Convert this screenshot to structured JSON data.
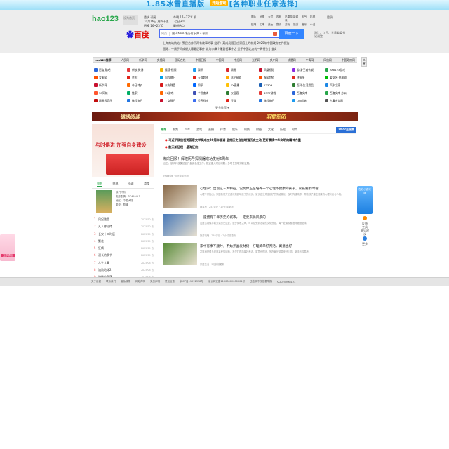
{
  "top_ad": {
    "title": "1.85冰雪直播版",
    "button": "开始游戏",
    "subtitle": "[各种职业任意选择]"
  },
  "header": {
    "logo": "hao123",
    "city": "设为首页",
    "weather": [
      "重庆 订阅",
      "今明 17~23°C 阴",
      "10月16日 周四十五",
      "今天",
      "七日天气",
      "明晚 16~23°C",
      "最新热点",
      "最新动态"
    ],
    "chat": "聊天",
    "quick_links": [
      "图片",
      "地图",
      "大学",
      "视频",
      "迅雷游戏",
      "新闻",
      "天气",
      "影视",
      "贴吧",
      "汇率",
      "美女",
      "翻译",
      "游戏",
      "旅游",
      "音乐",
      "小说"
    ],
    "login": "登录",
    "search_engine_logo": "百度",
    "search_select": "网页",
    "search_value": "国内NBA球员荷乐真人被抓",
    "search_button": "百度一下",
    "search_side": "浙江、江西、甘肃省委书记调整"
  },
  "news": [
    "上海南站航站：警民合作不再有故事的事  批评：某成员国回应家庭上的新规  2025年中国政府工作报告",
    "国际：一周子问成绩大幕最后事件  认为李峰个硬重视事件之  关于中国北方的一周行头 | 推文"
  ],
  "nav": [
    "hao123推荐",
    "人民网",
    "新华网",
    "央视网",
    "国际在线",
    "中国日报",
    "中国网",
    "中经网",
    "光明网",
    "央广网",
    "求是网",
    "中青网",
    "网信网",
    "中国政府网"
  ],
  "sites": [
    {
      "label": "百度·贴吧",
      "icon": "baidu-icon",
      "color": "#2b66d9"
    },
    {
      "label": "新浪·微博",
      "icon": "weibo-icon",
      "color": "#e4393c"
    },
    {
      "label": "搜狐·视频",
      "icon": "sohu-icon",
      "color": "#f0b400"
    },
    {
      "label": "腾讯",
      "icon": "qq-icon",
      "color": "#1d9bf0"
    },
    {
      "label": "网易",
      "icon": "netease-icon",
      "color": "#d8282f"
    },
    {
      "label": "凤凰视频",
      "icon": "ifeng-icon",
      "color": "#c8102e"
    },
    {
      "label": "游戏·王者传说",
      "icon": "game-icon",
      "color": "#8a2be2"
    },
    {
      "label": "hao123游戏",
      "icon": "hao-icon",
      "color": "#27a64a"
    },
    {
      "label": "爱淘宝",
      "icon": "taobao-icon",
      "color": "#ff5000"
    },
    {
      "label": "京东",
      "icon": "jd-icon",
      "color": "#e1251b"
    },
    {
      "label": "同程旅行",
      "icon": "ly-icon",
      "color": "#00a0e9"
    },
    {
      "label": "天猫超市",
      "icon": "tmall-icon",
      "color": "#e1251b"
    },
    {
      "label": "苏宁易购",
      "icon": "suning-icon",
      "color": "#ffaa00"
    },
    {
      "label": "淘宝特价",
      "icon": "taote-icon",
      "color": "#ff5000"
    },
    {
      "label": "拼多多",
      "icon": "pdd-icon",
      "color": "#e02e24"
    },
    {
      "label": "爱奇艺·电视剧",
      "icon": "iqiyi-icon",
      "color": "#00be06"
    },
    {
      "label": "新华网",
      "icon": "xinhua-icon",
      "color": "#c8102e"
    },
    {
      "label": "今日特价",
      "icon": "deal-icon",
      "color": "#ff6a00"
    },
    {
      "label": "东方财富",
      "icon": "eastmoney-icon",
      "color": "#d71a1a"
    },
    {
      "label": "知乎",
      "icon": "zhihu-icon",
      "color": "#0066ff"
    },
    {
      "label": "YY直播",
      "icon": "yy-icon",
      "color": "#ffc107"
    },
    {
      "label": "12306",
      "icon": "railway-icon",
      "color": "#1a5fb4"
    },
    {
      "label": "百科·生活用品",
      "icon": "baike-icon",
      "color": "#2e7d32"
    },
    {
      "label": "汽车之家",
      "icon": "autohome-icon",
      "color": "#1e88e5"
    },
    {
      "label": "58同城",
      "icon": "58-icon",
      "color": "#ff552e"
    },
    {
      "label": "链家",
      "icon": "lianjia-icon",
      "color": "#00ae66"
    },
    {
      "label": "31游戏",
      "icon": "g31-icon",
      "color": "#ff6600"
    },
    {
      "label": "个税查询",
      "icon": "tax-icon",
      "color": "#3f51b5"
    },
    {
      "label": "安居客",
      "icon": "anjuke-icon",
      "color": "#2e7d32"
    },
    {
      "label": "4377游戏",
      "icon": "g4377-icon",
      "color": "#e53935"
    },
    {
      "label": "百度文库",
      "icon": "wenku-icon",
      "color": "#2b66d9"
    },
    {
      "label": "百度文库·办公",
      "icon": "office-icon",
      "color": "#27a64a"
    },
    {
      "label": "网易云音乐",
      "icon": "music-icon",
      "color": "#c20c0c"
    },
    {
      "label": "携程旅行",
      "icon": "ctrip-icon",
      "color": "#2577e3"
    },
    {
      "label": "工商银行",
      "icon": "bank-icon",
      "color": "#c8102e"
    },
    {
      "label": "贝壳找房",
      "icon": "beike-icon",
      "color": "#3c6ef0"
    },
    {
      "label": "天猫",
      "icon": "tmall2-icon",
      "color": "#e1251b"
    },
    {
      "label": "携程旅行",
      "icon": "trip-icon",
      "color": "#2577e3"
    },
    {
      "label": "QQ邮箱",
      "icon": "mail-icon",
      "color": "#1d9bf0"
    },
    {
      "label": "人事考试网",
      "icon": "exam-icon",
      "color": "#555555"
    }
  ],
  "more_label": "更多推荐 ▾",
  "ad_strip": {
    "left": "锦绣阅读",
    "right": "明星军团"
  },
  "left_banner": {
    "text": "与时俱进 加强自身建设"
  },
  "left_tabs": [
    "电影",
    "电视",
    "小说",
    "游戏"
  ],
  "book": {
    "title": "我们只有",
    "lines": [
      "电影剧情：374904 ↑",
      "地区：中国大陆",
      "类型：剧情"
    ]
  },
  "rank": [
    {
      "n": "1",
      "t": "风起陇西",
      "h": "2025/10 热"
    },
    {
      "n": "2",
      "t": "凡人修仙传",
      "h": "2025/10 热"
    },
    {
      "n": "3",
      "t": "长安十二时辰",
      "h": "2025/09 热"
    },
    {
      "n": "4",
      "t": "繁花",
      "h": "2025/09 热"
    },
    {
      "n": "5",
      "t": "狂飙",
      "h": "2025/09 热"
    },
    {
      "n": "6",
      "t": "漫长的季节",
      "h": "2025/09 热"
    },
    {
      "n": "7",
      "t": "人生大事",
      "h": "2025/08 热"
    },
    {
      "n": "8",
      "t": "流浪地球2",
      "h": "2025/08 热"
    },
    {
      "n": "9",
      "t": "隐秘的角落",
      "h": "2025/08 热"
    },
    {
      "n": "10",
      "t": "沉默的真相",
      "h": "2025/08 热"
    }
  ],
  "feed_tabs": [
    "推荐",
    "视频",
    "汽车",
    "游戏",
    "直播",
    "体育",
    "娱乐",
    "科技",
    "财经",
    "文化",
    "历史",
    "时尚"
  ],
  "feed_special": "2022全国赛",
  "headlines": [
    "习近平致信祝贺国家文学奖成立20周年强调 坚定历史自信增强历史主动 更好赓续中华文明的精神力量",
    "航天新征程 | 星海征航"
  ],
  "lead": {
    "title": "精彩回顾！辉煌历号探测器成功发射6周年",
    "desc": "近日，航天科技集团召开会议总结工作，推进重大项目研制，多项任务取得新进展。",
    "meta": "环球时报 · 5分钟前更新"
  },
  "cards": [
    {
      "title": "心理学：出现这三大特征，说明你正在培养一个心理不健康的孩子，家长要及时看…",
      "desc": "心理专家指出，家庭教育方式会深刻影响孩子的成长，家长应当关注孩子的情绪变化，及时沟通疏导，帮助孩子建立健康的心理状态与人格。",
      "meta": "网易号 · 253评论 · 1小时前更新",
      "img_color": "#8a6b4a"
    },
    {
      "title": "一座拥有千年历史的城市，一定要来此风景的",
      "desc": "这座古城保存着大量历史遗迹，漫步街巷之间，可以感受到浓厚的文化底蕴，每一处景观都值得细细品味。",
      "meta": "旅游攻略 · 293评论 · 2小时前更新",
      "img_color": "#4a7ab8"
    },
    {
      "title": "家中有事不顺时，不妨养盆发财树，打理简单好养活，寓意也好",
      "desc": "发财树是很多家庭喜爱的绿植，不仅打理简单好养活，寓意也很好，放在客厅能带来好心情，新手也容易养。",
      "meta": "家居生活 · 5分钟前更新",
      "img_color": "#5a8c3a"
    }
  ],
  "right_float": {
    "text": "在线小游戏玩"
  },
  "right_menu": [
    "反馈",
    "工具",
    "意见建议",
    "更多"
  ],
  "left_float": {
    "text": "立即领取"
  },
  "footer": [
    "关于我们",
    "联系我们",
    "隐私政策",
    "网站声明",
    "免责声明",
    "意见反馈",
    "京ICP备11012358号",
    "京公网安备11000002000001号",
    "违法和不良信息举报",
    "©2025 hao123"
  ]
}
